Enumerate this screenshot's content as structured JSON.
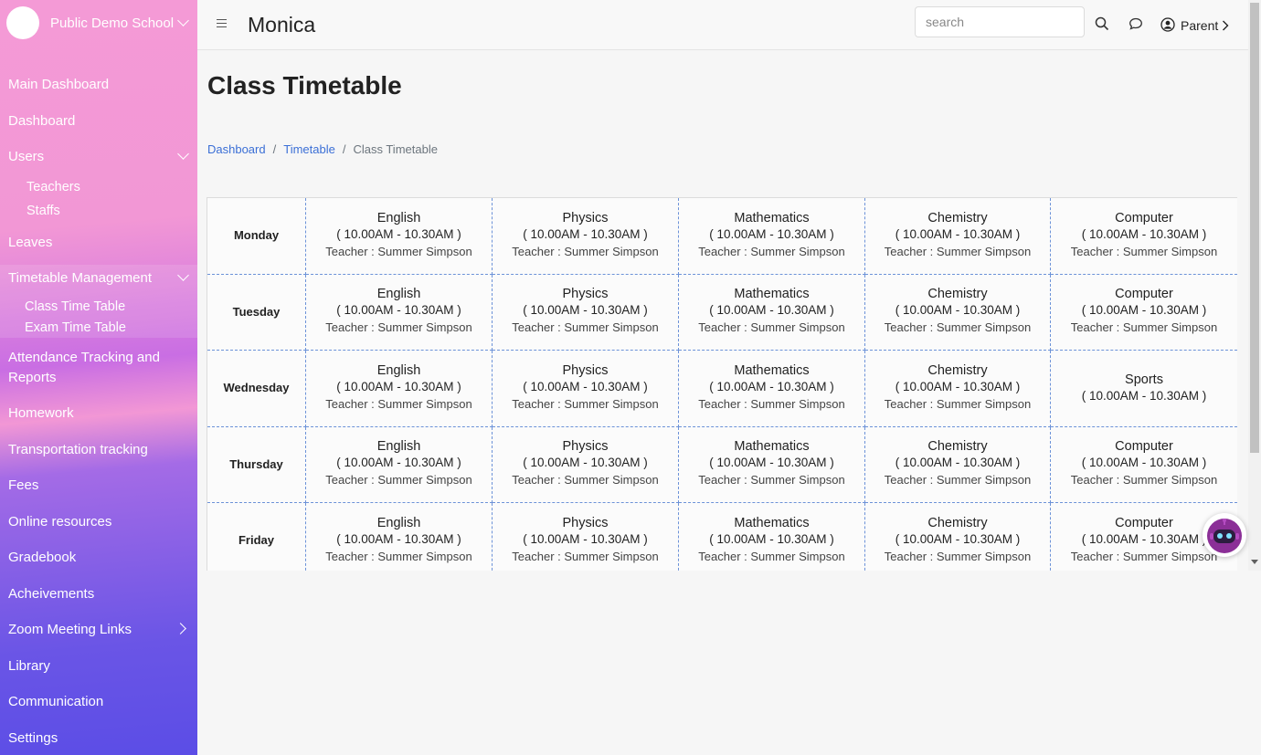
{
  "sidebar": {
    "school_name": "Public Demo School",
    "items": {
      "main_dashboard": "Main Dashboard",
      "dashboard": "Dashboard",
      "users": "Users",
      "teachers": "Teachers",
      "staffs": "Staffs",
      "leaves": "Leaves",
      "timetable_management": "Timetable Management",
      "class_time_table": "Class Time Table",
      "exam_time_table": "Exam Time Table",
      "attendance_line1": "Attendance Tracking and",
      "attendance_line2": "Reports",
      "homework": "Homework",
      "transportation": "Transportation tracking",
      "fees": "Fees",
      "online_resources": "Online resources",
      "gradebook": "Gradebook",
      "achievements": "Acheivements",
      "zoom": "Zoom Meeting Links",
      "library": "Library",
      "communication": "Communication",
      "settings": "Settings"
    }
  },
  "header": {
    "brand": "Monica",
    "search_placeholder": "search",
    "user_label": "Parent"
  },
  "page": {
    "title": "Class Timetable",
    "breadcrumb": [
      "Dashboard",
      "Timetable",
      "Class Timetable"
    ]
  },
  "timetable": [
    {
      "day": "Monday",
      "slots": [
        {
          "subject": "English",
          "time": "( 10.00AM - 10.30AM )",
          "teacher": "Teacher : Summer Simpson"
        },
        {
          "subject": "Physics",
          "time": "( 10.00AM - 10.30AM )",
          "teacher": "Teacher : Summer Simpson"
        },
        {
          "subject": "Mathematics",
          "time": "( 10.00AM - 10.30AM )",
          "teacher": "Teacher : Summer Simpson"
        },
        {
          "subject": "Chemistry",
          "time": "( 10.00AM - 10.30AM )",
          "teacher": "Teacher : Summer Simpson"
        },
        {
          "subject": "Computer",
          "time": "( 10.00AM - 10.30AM )",
          "teacher": "Teacher : Summer Simpson"
        }
      ]
    },
    {
      "day": "Tuesday",
      "slots": [
        {
          "subject": "English",
          "time": "( 10.00AM - 10.30AM )",
          "teacher": "Teacher : Summer Simpson"
        },
        {
          "subject": "Physics",
          "time": "( 10.00AM - 10.30AM )",
          "teacher": "Teacher : Summer Simpson"
        },
        {
          "subject": "Mathematics",
          "time": "( 10.00AM - 10.30AM )",
          "teacher": "Teacher : Summer Simpson"
        },
        {
          "subject": "Chemistry",
          "time": "( 10.00AM - 10.30AM )",
          "teacher": "Teacher : Summer Simpson"
        },
        {
          "subject": "Computer",
          "time": "( 10.00AM - 10.30AM )",
          "teacher": "Teacher : Summer Simpson"
        }
      ]
    },
    {
      "day": "Wednesday",
      "slots": [
        {
          "subject": "English",
          "time": "( 10.00AM - 10.30AM )",
          "teacher": "Teacher : Summer Simpson"
        },
        {
          "subject": "Physics",
          "time": "( 10.00AM - 10.30AM )",
          "teacher": "Teacher : Summer Simpson"
        },
        {
          "subject": "Mathematics",
          "time": "( 10.00AM - 10.30AM )",
          "teacher": "Teacher : Summer Simpson"
        },
        {
          "subject": "Chemistry",
          "time": "( 10.00AM - 10.30AM )",
          "teacher": "Teacher : Summer Simpson"
        },
        {
          "subject": "Sports",
          "time": "( 10.00AM - 10.30AM )",
          "teacher": ""
        }
      ]
    },
    {
      "day": "Thursday",
      "slots": [
        {
          "subject": "English",
          "time": "( 10.00AM - 10.30AM )",
          "teacher": "Teacher : Summer Simpson"
        },
        {
          "subject": "Physics",
          "time": "( 10.00AM - 10.30AM )",
          "teacher": "Teacher : Summer Simpson"
        },
        {
          "subject": "Mathematics",
          "time": "( 10.00AM - 10.30AM )",
          "teacher": "Teacher : Summer Simpson"
        },
        {
          "subject": "Chemistry",
          "time": "( 10.00AM - 10.30AM )",
          "teacher": "Teacher : Summer Simpson"
        },
        {
          "subject": "Computer",
          "time": "( 10.00AM - 10.30AM )",
          "teacher": "Teacher : Summer Simpson"
        }
      ]
    },
    {
      "day": "Friday",
      "slots": [
        {
          "subject": "English",
          "time": "( 10.00AM - 10.30AM )",
          "teacher": "Teacher : Summer Simpson"
        },
        {
          "subject": "Physics",
          "time": "( 10.00AM - 10.30AM )",
          "teacher": "Teacher : Summer Simpson"
        },
        {
          "subject": "Mathematics",
          "time": "( 10.00AM - 10.30AM )",
          "teacher": "Teacher : Summer Simpson"
        },
        {
          "subject": "Chemistry",
          "time": "( 10.00AM - 10.30AM )",
          "teacher": "Teacher : Summer Simpson"
        },
        {
          "subject": "Computer",
          "time": "( 10.00AM - 10.30AM )",
          "teacher": "Teacher : Summer Simpson"
        }
      ]
    }
  ],
  "colors": {
    "link": "#3b6fd6",
    "sidebar_top": "#f49ad6",
    "sidebar_bottom": "#5b4de6",
    "cell_border": "#6c92d8"
  },
  "icons": {
    "menu": "hamburger-icon",
    "search": "search-icon",
    "chat": "chat-bubble-icon",
    "user": "user-circle-icon",
    "assistant": "robot-assistant-icon"
  }
}
